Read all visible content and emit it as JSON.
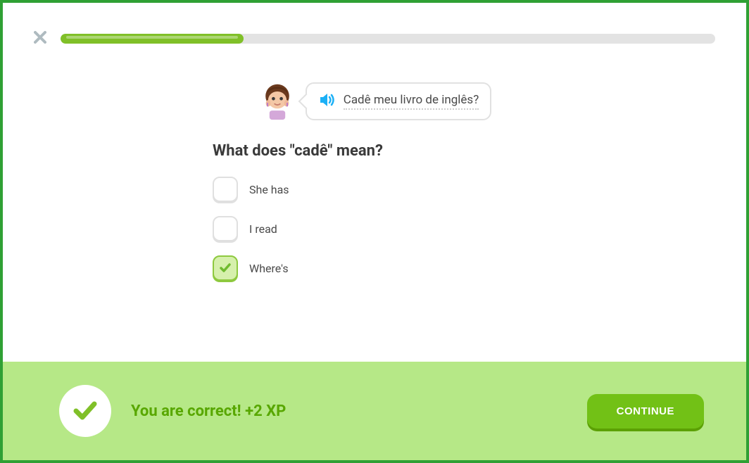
{
  "progress": {
    "percent": 28
  },
  "prompt": {
    "sentence": "Cadê meu livro de inglês?"
  },
  "question": {
    "title": "What does \"cadê\" mean?",
    "options": [
      {
        "label": "She has",
        "selected": false
      },
      {
        "label": "I read",
        "selected": false
      },
      {
        "label": "Where's",
        "selected": true
      }
    ]
  },
  "result": {
    "message": "You are correct! +2 XP",
    "button": "CONTINUE"
  }
}
